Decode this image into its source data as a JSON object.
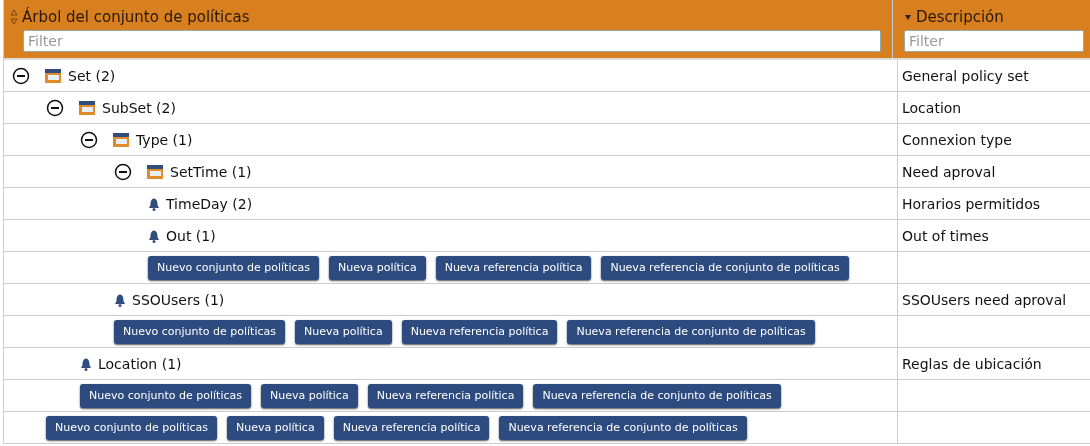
{
  "columns": [
    {
      "title": "Árbol del conjunto de políticas",
      "sorted": false,
      "filter": {
        "placeholder": "Filter"
      }
    },
    {
      "title": "Descripción",
      "sorted": true,
      "filter": {
        "placeholder": "Filter"
      }
    }
  ],
  "nodes": [
    {
      "kind": "set",
      "label": "Set (2)",
      "description": "General policy set",
      "expanded": true,
      "children": [
        {
          "kind": "set",
          "label": "SubSet (2)",
          "description": "Location",
          "expanded": true,
          "children": [
            {
              "kind": "set",
              "label": "Type (1)",
              "description": "Connexion type",
              "expanded": true,
              "children": [
                {
                  "kind": "set",
                  "label": "SetTime (1)",
                  "description": "Need aproval",
                  "expanded": true,
                  "children": [
                    {
                      "kind": "policy",
                      "label": "TimeDay (2)",
                      "description": "Horarios permitidos"
                    },
                    {
                      "kind": "policy",
                      "label": "Out (1)",
                      "description": "Out of times"
                    }
                  ],
                  "actions": [
                    "Nuevo conjunto de políticas",
                    "Nueva política",
                    "Nueva referencia política",
                    "Nueva referencia de conjunto de políticas"
                  ]
                },
                {
                  "kind": "policy",
                  "label": "SSOUsers (1)",
                  "description": "SSOUsers need aproval"
                }
              ],
              "actions": [
                "Nuevo conjunto de políticas",
                "Nueva política",
                "Nueva referencia política",
                "Nueva referencia de conjunto de políticas"
              ]
            },
            {
              "kind": "policy",
              "label": "Location (1)",
              "description": "Reglas de ubicación"
            }
          ],
          "actions": [
            "Nuevo conjunto de políticas",
            "Nueva política",
            "Nueva referencia política",
            "Nueva referencia de conjunto de políticas"
          ]
        }
      ],
      "actions": [
        "Nuevo conjunto de políticas",
        "Nueva política",
        "Nueva referencia política",
        "Nueva referencia de conjunto de políticas"
      ]
    }
  ]
}
